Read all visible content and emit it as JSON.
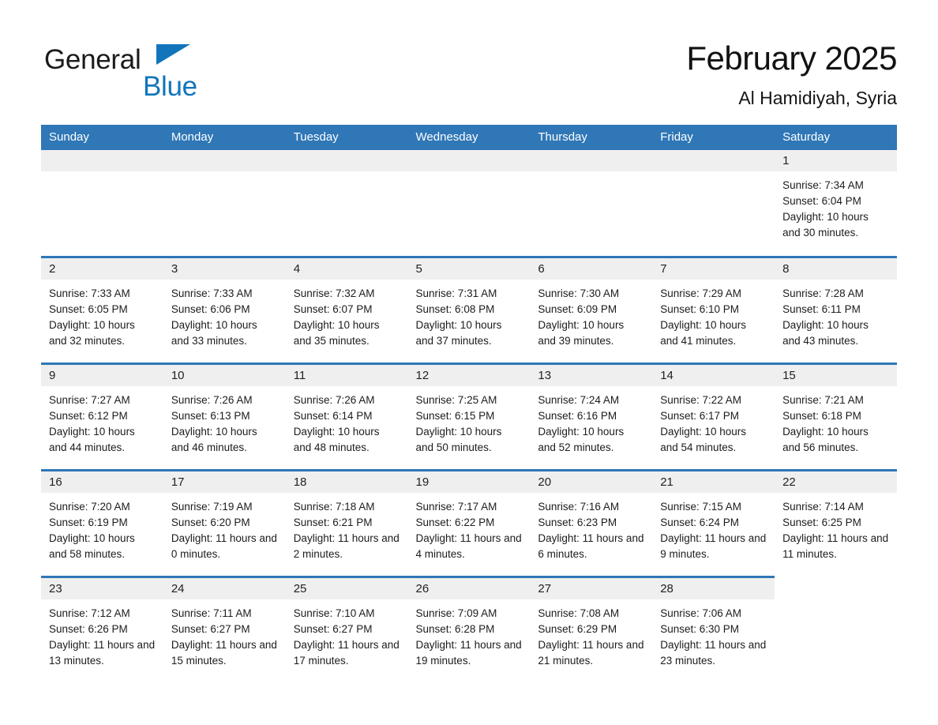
{
  "brand": {
    "name_part1": "General",
    "name_part2": "Blue",
    "accent_color": "#1275bc",
    "triangle_icon": "triangle-icon"
  },
  "header": {
    "title": "February 2025",
    "subtitle": "Al Hamidiyah, Syria"
  },
  "theme": {
    "header_blue": "#2f77b6",
    "daynum_gray": "#efefef",
    "text_dark": "#1c1c1c"
  },
  "calendar": {
    "weekdays": [
      "Sunday",
      "Monday",
      "Tuesday",
      "Wednesday",
      "Thursday",
      "Friday",
      "Saturday"
    ],
    "labels": {
      "sunrise": "Sunrise:",
      "sunset": "Sunset:",
      "daylight": "Daylight:"
    },
    "weeks": [
      [
        {
          "day": "",
          "sunrise": "",
          "sunset": "",
          "daylight": ""
        },
        {
          "day": "",
          "sunrise": "",
          "sunset": "",
          "daylight": ""
        },
        {
          "day": "",
          "sunrise": "",
          "sunset": "",
          "daylight": ""
        },
        {
          "day": "",
          "sunrise": "",
          "sunset": "",
          "daylight": ""
        },
        {
          "day": "",
          "sunrise": "",
          "sunset": "",
          "daylight": ""
        },
        {
          "day": "",
          "sunrise": "",
          "sunset": "",
          "daylight": ""
        },
        {
          "day": "1",
          "sunrise": "Sunrise: 7:34 AM",
          "sunset": "Sunset: 6:04 PM",
          "daylight": "Daylight: 10 hours and 30 minutes."
        }
      ],
      [
        {
          "day": "2",
          "sunrise": "Sunrise: 7:33 AM",
          "sunset": "Sunset: 6:05 PM",
          "daylight": "Daylight: 10 hours and 32 minutes."
        },
        {
          "day": "3",
          "sunrise": "Sunrise: 7:33 AM",
          "sunset": "Sunset: 6:06 PM",
          "daylight": "Daylight: 10 hours and 33 minutes."
        },
        {
          "day": "4",
          "sunrise": "Sunrise: 7:32 AM",
          "sunset": "Sunset: 6:07 PM",
          "daylight": "Daylight: 10 hours and 35 minutes."
        },
        {
          "day": "5",
          "sunrise": "Sunrise: 7:31 AM",
          "sunset": "Sunset: 6:08 PM",
          "daylight": "Daylight: 10 hours and 37 minutes."
        },
        {
          "day": "6",
          "sunrise": "Sunrise: 7:30 AM",
          "sunset": "Sunset: 6:09 PM",
          "daylight": "Daylight: 10 hours and 39 minutes."
        },
        {
          "day": "7",
          "sunrise": "Sunrise: 7:29 AM",
          "sunset": "Sunset: 6:10 PM",
          "daylight": "Daylight: 10 hours and 41 minutes."
        },
        {
          "day": "8",
          "sunrise": "Sunrise: 7:28 AM",
          "sunset": "Sunset: 6:11 PM",
          "daylight": "Daylight: 10 hours and 43 minutes."
        }
      ],
      [
        {
          "day": "9",
          "sunrise": "Sunrise: 7:27 AM",
          "sunset": "Sunset: 6:12 PM",
          "daylight": "Daylight: 10 hours and 44 minutes."
        },
        {
          "day": "10",
          "sunrise": "Sunrise: 7:26 AM",
          "sunset": "Sunset: 6:13 PM",
          "daylight": "Daylight: 10 hours and 46 minutes."
        },
        {
          "day": "11",
          "sunrise": "Sunrise: 7:26 AM",
          "sunset": "Sunset: 6:14 PM",
          "daylight": "Daylight: 10 hours and 48 minutes."
        },
        {
          "day": "12",
          "sunrise": "Sunrise: 7:25 AM",
          "sunset": "Sunset: 6:15 PM",
          "daylight": "Daylight: 10 hours and 50 minutes."
        },
        {
          "day": "13",
          "sunrise": "Sunrise: 7:24 AM",
          "sunset": "Sunset: 6:16 PM",
          "daylight": "Daylight: 10 hours and 52 minutes."
        },
        {
          "day": "14",
          "sunrise": "Sunrise: 7:22 AM",
          "sunset": "Sunset: 6:17 PM",
          "daylight": "Daylight: 10 hours and 54 minutes."
        },
        {
          "day": "15",
          "sunrise": "Sunrise: 7:21 AM",
          "sunset": "Sunset: 6:18 PM",
          "daylight": "Daylight: 10 hours and 56 minutes."
        }
      ],
      [
        {
          "day": "16",
          "sunrise": "Sunrise: 7:20 AM",
          "sunset": "Sunset: 6:19 PM",
          "daylight": "Daylight: 10 hours and 58 minutes."
        },
        {
          "day": "17",
          "sunrise": "Sunrise: 7:19 AM",
          "sunset": "Sunset: 6:20 PM",
          "daylight": "Daylight: 11 hours and 0 minutes."
        },
        {
          "day": "18",
          "sunrise": "Sunrise: 7:18 AM",
          "sunset": "Sunset: 6:21 PM",
          "daylight": "Daylight: 11 hours and 2 minutes."
        },
        {
          "day": "19",
          "sunrise": "Sunrise: 7:17 AM",
          "sunset": "Sunset: 6:22 PM",
          "daylight": "Daylight: 11 hours and 4 minutes."
        },
        {
          "day": "20",
          "sunrise": "Sunrise: 7:16 AM",
          "sunset": "Sunset: 6:23 PM",
          "daylight": "Daylight: 11 hours and 6 minutes."
        },
        {
          "day": "21",
          "sunrise": "Sunrise: 7:15 AM",
          "sunset": "Sunset: 6:24 PM",
          "daylight": "Daylight: 11 hours and 9 minutes."
        },
        {
          "day": "22",
          "sunrise": "Sunrise: 7:14 AM",
          "sunset": "Sunset: 6:25 PM",
          "daylight": "Daylight: 11 hours and 11 minutes."
        }
      ],
      [
        {
          "day": "23",
          "sunrise": "Sunrise: 7:12 AM",
          "sunset": "Sunset: 6:26 PM",
          "daylight": "Daylight: 11 hours and 13 minutes."
        },
        {
          "day": "24",
          "sunrise": "Sunrise: 7:11 AM",
          "sunset": "Sunset: 6:27 PM",
          "daylight": "Daylight: 11 hours and 15 minutes."
        },
        {
          "day": "25",
          "sunrise": "Sunrise: 7:10 AM",
          "sunset": "Sunset: 6:27 PM",
          "daylight": "Daylight: 11 hours and 17 minutes."
        },
        {
          "day": "26",
          "sunrise": "Sunrise: 7:09 AM",
          "sunset": "Sunset: 6:28 PM",
          "daylight": "Daylight: 11 hours and 19 minutes."
        },
        {
          "day": "27",
          "sunrise": "Sunrise: 7:08 AM",
          "sunset": "Sunset: 6:29 PM",
          "daylight": "Daylight: 11 hours and 21 minutes."
        },
        {
          "day": "28",
          "sunrise": "Sunrise: 7:06 AM",
          "sunset": "Sunset: 6:30 PM",
          "daylight": "Daylight: 11 hours and 23 minutes."
        },
        {
          "day": "",
          "sunrise": "",
          "sunset": "",
          "daylight": ""
        }
      ]
    ]
  }
}
